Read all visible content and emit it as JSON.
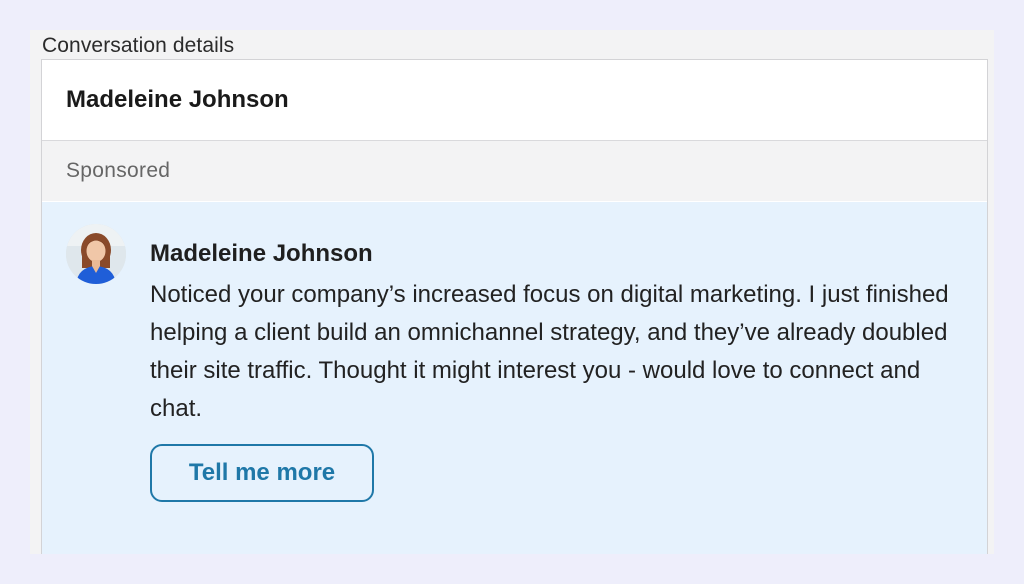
{
  "panel": {
    "title": "Conversation details"
  },
  "conversation": {
    "header_name": "Madeleine Johnson",
    "sponsored_label": "Sponsored"
  },
  "message": {
    "sender_name": "Madeleine Johnson",
    "body": "Noticed your company’s increased focus on digital marketing. I just finished helping a client build an omnichannel strategy, and they’ve already doubled their site traffic. Thought it might interest you - would love to connect and chat.",
    "cta_label": "Tell me more",
    "avatar_icon": "avatar-photo-icon"
  },
  "colors": {
    "page_background": "#eeeefb",
    "message_background": "#e6f2fd",
    "cta_accent": "#1f78a8",
    "sponsored_text": "#666666"
  }
}
